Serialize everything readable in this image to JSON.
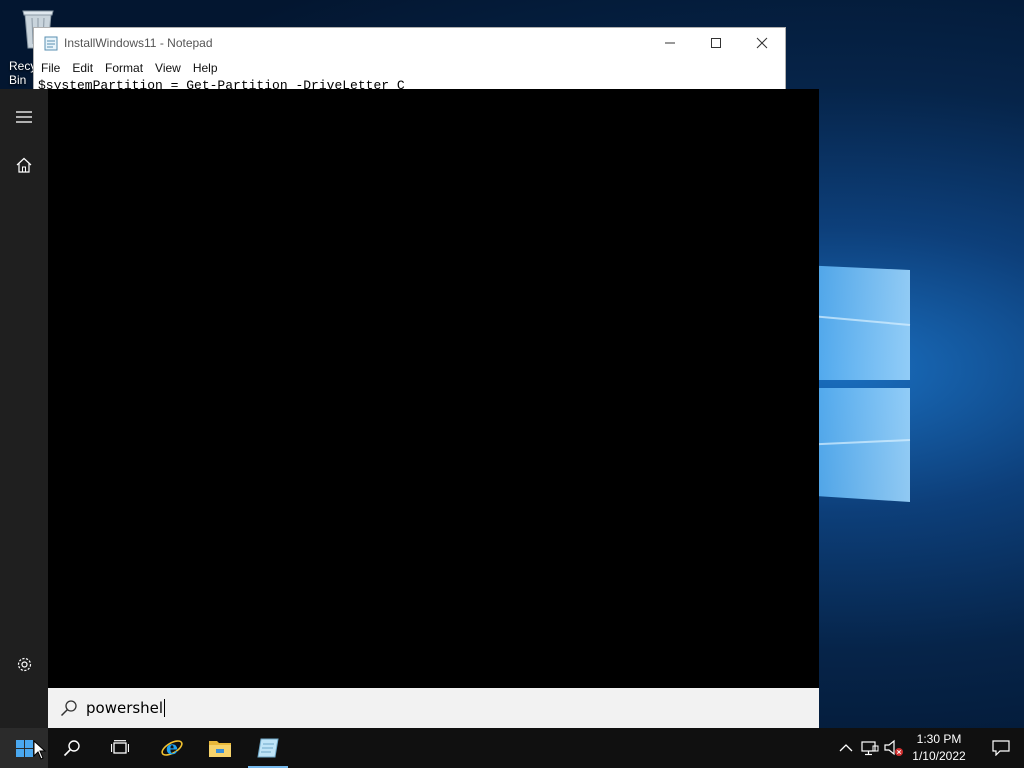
{
  "desktop": {
    "recycle_bin_label": "Recycle Bin"
  },
  "notepad": {
    "title": "InstallWindows11 - Notepad",
    "menus": [
      "File",
      "Edit",
      "Format",
      "View",
      "Help"
    ],
    "editor_first_line": "$systemPartition = Get-Partition -DriveLetter C"
  },
  "start_menu": {
    "rail_icons": [
      "hamburger-menu-icon",
      "home-icon",
      "settings-gear-icon"
    ],
    "search": {
      "value": "powershel",
      "icon": "search-icon"
    }
  },
  "taskbar": {
    "buttons": [
      {
        "name": "start-button",
        "icon": "windows-logo-icon"
      },
      {
        "name": "search-button",
        "icon": "search-icon"
      },
      {
        "name": "task-view-button",
        "icon": "task-view-icon"
      },
      {
        "name": "internet-explorer-button",
        "icon": "internet-explorer-icon"
      },
      {
        "name": "file-explorer-button",
        "icon": "folder-icon"
      },
      {
        "name": "notepad-taskbar-button",
        "icon": "notepad-icon",
        "active": true
      }
    ],
    "tray": {
      "icons": [
        "chevron-up-icon",
        "network-icon",
        "volume-muted-icon"
      ],
      "time": "1:30 PM",
      "date": "1/10/2022"
    }
  },
  "colors": {
    "taskbar": "#101010",
    "start_rail": "#1f1f1f",
    "start_panel": "#000000",
    "search_box": "#f2f2f2",
    "active_indicator": "#76b9ed"
  }
}
